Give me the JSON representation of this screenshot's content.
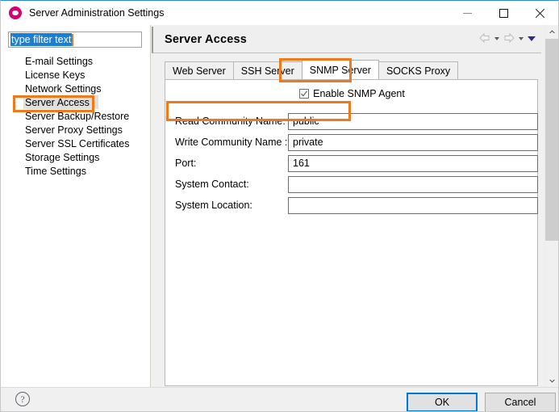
{
  "window": {
    "title": "Server Administration Settings",
    "app_icon": "eye-logo-icon",
    "minimize_label": "Minimize",
    "maximize_label": "Maximize",
    "close_label": "Close"
  },
  "sidebar": {
    "filter": {
      "value": "type filter text",
      "placeholder": "type filter text"
    },
    "items": [
      {
        "label": "E-mail Settings",
        "selected": false
      },
      {
        "label": "License Keys",
        "selected": false
      },
      {
        "label": "Network Settings",
        "selected": false
      },
      {
        "label": "Server Access",
        "selected": true
      },
      {
        "label": "Server Backup/Restore",
        "selected": false
      },
      {
        "label": "Server Proxy Settings",
        "selected": false
      },
      {
        "label": "Server SSL Certificates",
        "selected": false
      },
      {
        "label": "Storage Settings",
        "selected": false
      },
      {
        "label": "Time Settings",
        "selected": false
      }
    ]
  },
  "header": {
    "title": "Server Access",
    "nav": {
      "back_icon": "back-arrow-icon",
      "back_menu_icon": "chevron-down-icon",
      "forward_icon": "forward-arrow-icon",
      "forward_menu_icon": "chevron-down-icon",
      "overflow_icon": "chevron-down-filled-icon"
    }
  },
  "tabs": [
    {
      "label": "Web Server",
      "active": false
    },
    {
      "label": "SSH Server",
      "active": false
    },
    {
      "label": "SNMP Server",
      "active": true
    },
    {
      "label": "SOCKS Proxy",
      "active": false
    }
  ],
  "form": {
    "enable_checkbox": {
      "label": "Enable SNMP Agent",
      "checked": true,
      "icon": "check-icon"
    },
    "fields": [
      {
        "label": "Read Community Name:",
        "value": "public"
      },
      {
        "label": "Write Community Name :",
        "value": "private"
      },
      {
        "label": "Port:",
        "value": "161"
      },
      {
        "label": "System Contact:",
        "value": ""
      },
      {
        "label": "System Location:",
        "value": ""
      }
    ]
  },
  "scrollbar": {
    "up_icon": "chevron-up-icon",
    "down_icon": "chevron-down-icon"
  },
  "footer": {
    "help_icon": "question-mark-icon",
    "help_label": "?",
    "ok_label": "OK",
    "cancel_label": "Cancel"
  },
  "annotations": {
    "accent_color": "#f07a1a",
    "highlights": [
      {
        "name": "sidebar-item-server-access"
      },
      {
        "name": "tab-snmp-server"
      },
      {
        "name": "read-community-name-row"
      }
    ]
  },
  "colors": {
    "accent_orange": "#f07a1a",
    "selection_blue": "#1a7fd4",
    "focus_blue": "#0078d7",
    "title_accent": "#2a8ad4",
    "app_icon_pink": "#d6006e"
  }
}
